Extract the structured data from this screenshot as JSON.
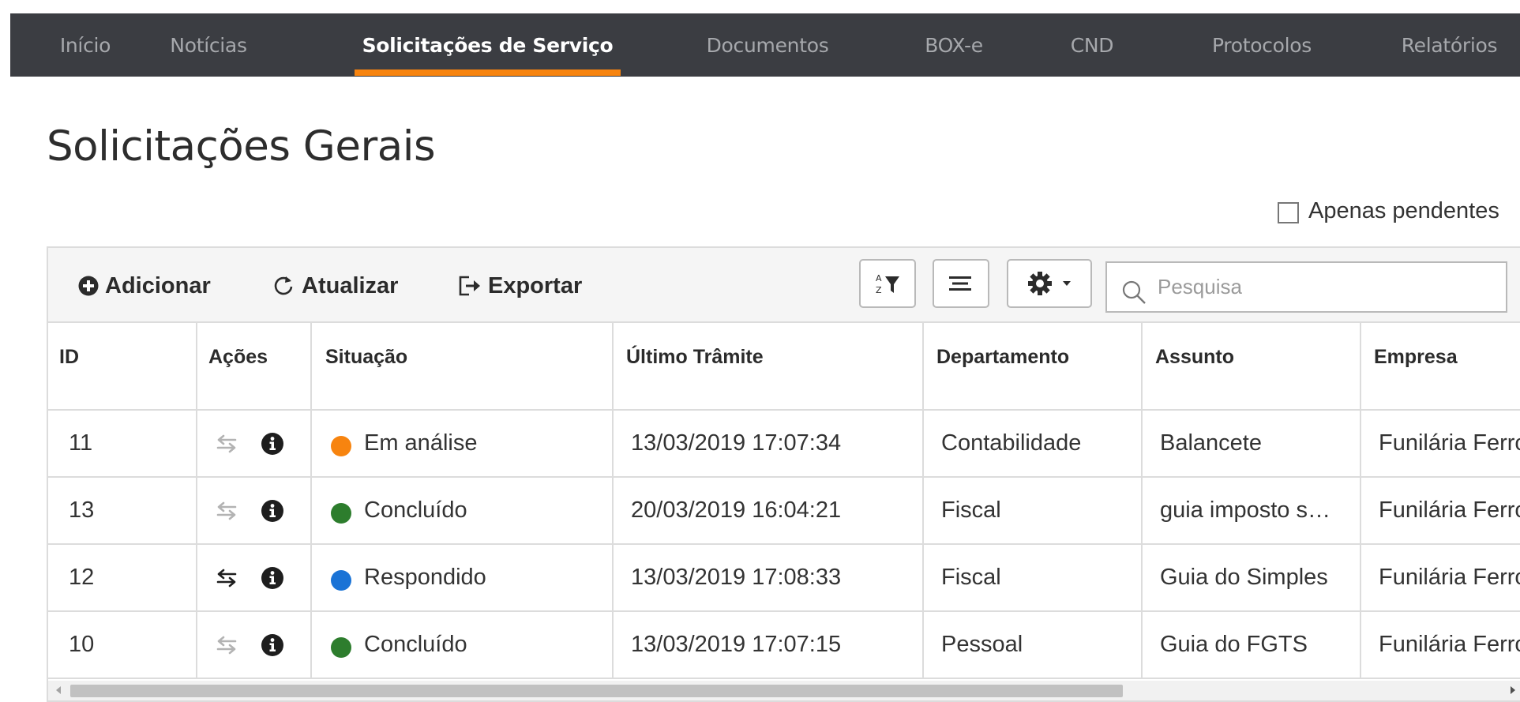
{
  "nav": {
    "tabs": [
      {
        "label": "Início"
      },
      {
        "label": "Notícias"
      },
      {
        "label": "Solicitações de Serviço",
        "active": true
      },
      {
        "label": "Documentos"
      },
      {
        "label": "BOX-e"
      },
      {
        "label": "CND"
      },
      {
        "label": "Protocolos"
      },
      {
        "label": "Relatórios"
      }
    ],
    "accent_color": "#f7840f"
  },
  "page": {
    "title": "Solicitações Gerais",
    "pending_only_label": "Apenas pendentes",
    "pending_only_checked": false
  },
  "toolbar": {
    "add_label": "Adicionar",
    "refresh_label": "Atualizar",
    "export_label": "Exportar",
    "search_placeholder": "Pesquisa",
    "search_value": ""
  },
  "table": {
    "columns": [
      "ID",
      "Ações",
      "Situação",
      "Último Trâmite",
      "Departamento",
      "Assunto",
      "Empresa"
    ],
    "rows": [
      {
        "id": "11",
        "swap_active": false,
        "status": "Em análise",
        "status_color": "#f7840f",
        "last": "13/03/2019 17:07:34",
        "dept": "Contabilidade",
        "subject": "Balancete",
        "company": "Funilária Ferro"
      },
      {
        "id": "13",
        "swap_active": false,
        "status": "Concluído",
        "status_color": "#2d7d2d",
        "last": "20/03/2019 16:04:21",
        "dept": "Fiscal",
        "subject": "guia imposto s…",
        "company": "Funilária Ferro"
      },
      {
        "id": "12",
        "swap_active": true,
        "status": "Respondido",
        "status_color": "#1a73d6",
        "last": "13/03/2019 17:08:33",
        "dept": "Fiscal",
        "subject": "Guia do Simples",
        "company": "Funilária Ferro"
      },
      {
        "id": "10",
        "swap_active": false,
        "status": "Concluído",
        "status_color": "#2d7d2d",
        "last": "13/03/2019 17:07:15",
        "dept": "Pessoal",
        "subject": "Guia do FGTS",
        "company": "Funilária Ferro"
      }
    ]
  },
  "icons": {
    "add": "plus-circle-icon",
    "refresh": "refresh-icon",
    "export": "export-icon",
    "sort": "sort-az-icon",
    "group": "lines-icon",
    "settings": "gear-icon",
    "search": "search-icon",
    "swap": "swap-icon",
    "info": "info-icon"
  }
}
